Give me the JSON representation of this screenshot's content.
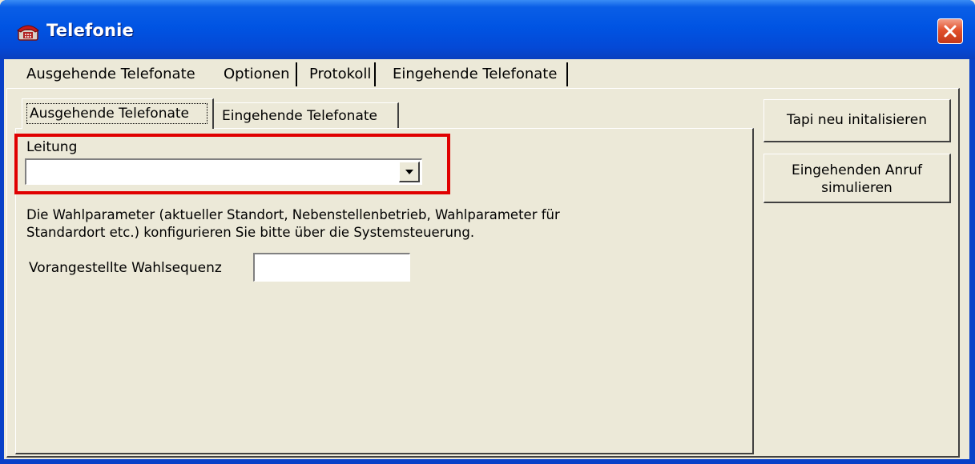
{
  "window": {
    "title": "Telefonie"
  },
  "outer_tabs": [
    {
      "label": "Ausgehende Telefonate",
      "active": false
    },
    {
      "label": "Optionen",
      "active": true
    },
    {
      "label": "Protokoll",
      "active": false
    },
    {
      "label": "Eingehende Telefonate",
      "active": false
    }
  ],
  "inner_tabs": [
    {
      "label": "Ausgehende Telefonate",
      "active": true
    },
    {
      "label": "Eingehende Telefonate",
      "active": false
    }
  ],
  "leitung": {
    "label": "Leitung",
    "value": ""
  },
  "description": {
    "line1": "Die Wahlparameter (aktueller Standort, Nebenstellenbetrieb, Wahlparameter für",
    "line2": "Standardort etc.) konfigurieren Sie bitte über die Systemsteuerung."
  },
  "prefix": {
    "label": "Vorangestellte Wahlsequenz",
    "value": ""
  },
  "buttons": {
    "tapi_reinit": "Tapi neu initalisieren",
    "simulate_line1": "Eingehenden Anruf",
    "simulate_line2": "simulieren"
  },
  "colors": {
    "titlebar": "#0054e3",
    "highlight": "#e00000",
    "face": "#ece9d8"
  }
}
